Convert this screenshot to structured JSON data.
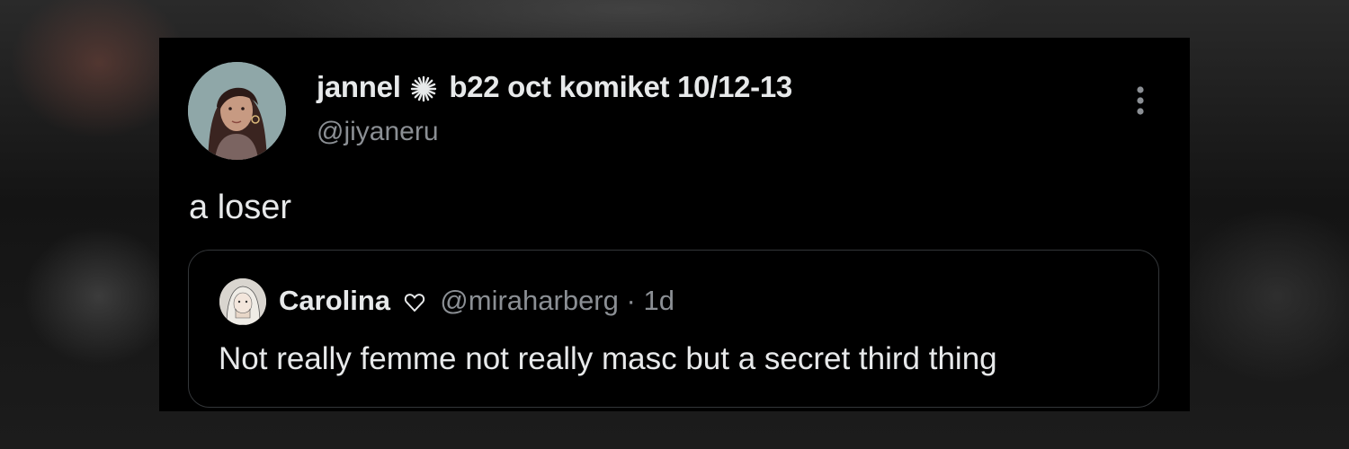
{
  "tweet": {
    "author": {
      "name": "jannel",
      "name_suffix": "b22 oct komiket 10/12-13",
      "handle": "@jiyaneru"
    },
    "text": "a loser",
    "menu_icon": "more-vertical-icon",
    "quoted": {
      "name": "Carolina",
      "heart_icon": "heart-outline-icon",
      "handle": "@miraharberg",
      "separator": "·",
      "time": "1d",
      "text": "Not really femme not really masc but a secret third thing"
    }
  },
  "colors": {
    "background": "#000000",
    "text": "#e7e9ea",
    "secondary_text": "#8b8f94",
    "border": "#333639"
  }
}
